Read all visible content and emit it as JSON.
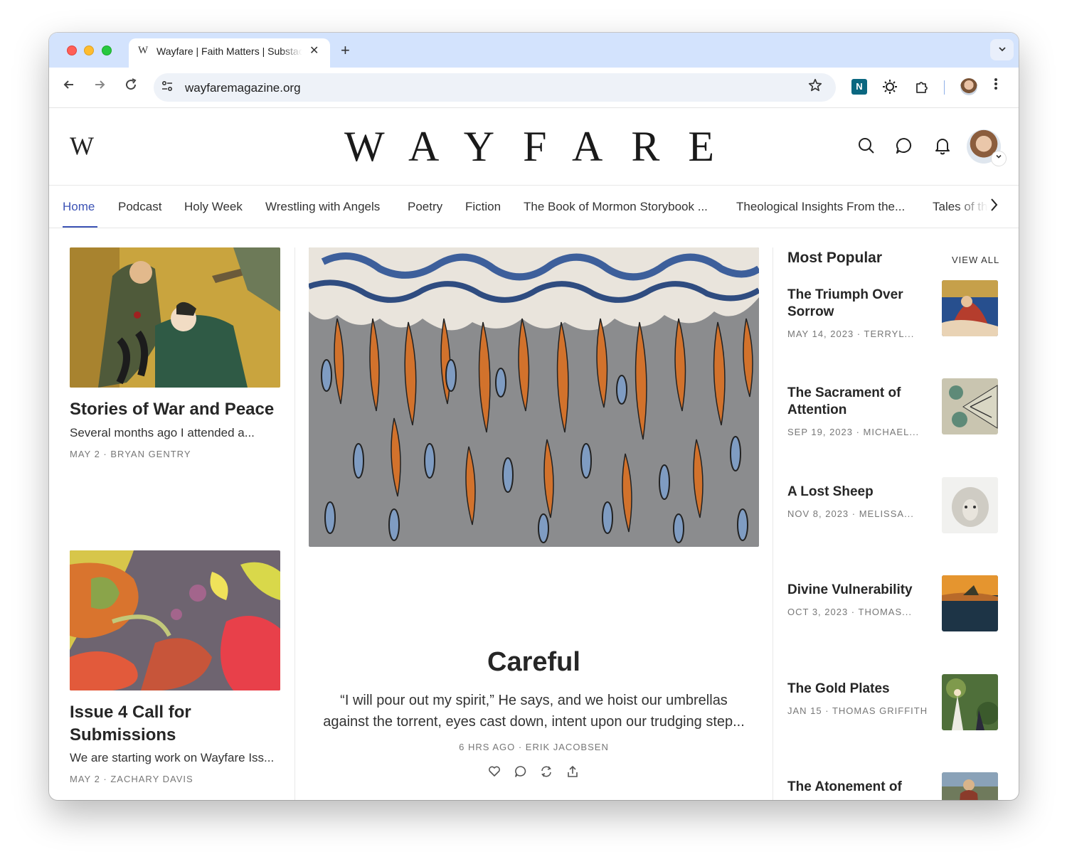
{
  "browser": {
    "tab_title": "Wayfare | Faith Matters | Substack",
    "tab_favicon": "W",
    "url": "wayfaremagazine.org",
    "new_tab_symbol": "+",
    "close_symbol": "✕",
    "dropdown_symbol": "⌄",
    "ext_label": "N"
  },
  "site": {
    "logo": "W",
    "wordmark": "WAYFARE"
  },
  "nav": {
    "items": [
      "Home",
      "Podcast",
      "Holy Week",
      "Wrestling with Angels",
      "Poetry",
      "Fiction",
      "The Book of Mormon Storybook ...",
      "Theological Insights From the..."
    ],
    "overflow_item": "Tales of the"
  },
  "left_cards": [
    {
      "title": "Stories of War and Peace",
      "subtitle": "Several months ago I attended a...",
      "meta": "MAY 2 · BRYAN GENTRY"
    },
    {
      "title": "Issue 4 Call for Submissions",
      "subtitle": "We are starting work on Wayfare Iss...",
      "meta": "MAY 2 · ZACHARY DAVIS"
    }
  ],
  "hero": {
    "title": "Careful",
    "subtitle": "“I will pour out my spirit,” He says, and we hoist our umbrellas against the torrent, eyes cast down, intent upon our trudging step...",
    "meta": "6 HRS AGO · ERIK JACOBSEN"
  },
  "sidebar": {
    "title": "Most Popular",
    "view_all": "VIEW ALL",
    "items": [
      {
        "title": "The Triumph Over Sorrow",
        "meta": "MAY 14, 2023 · TERRYL..."
      },
      {
        "title": "The Sacrament of Attention",
        "meta": "SEP 19, 2023 · MICHAEL..."
      },
      {
        "title": "A Lost Sheep",
        "meta": "NOV 8, 2023 · MELISSA..."
      },
      {
        "title": "Divine Vulnerability",
        "meta": "OCT 3, 2023 · THOMAS..."
      },
      {
        "title": "The Gold Plates",
        "meta": "JAN 15 · THOMAS GRIFFITH"
      },
      {
        "title": "The Atonement of",
        "meta": ""
      }
    ]
  },
  "colors": {
    "accent": "#3c53b5",
    "tabstrip": "#d3e3fd",
    "text": "#262626",
    "meta": "#777777"
  },
  "icons": [
    "back-icon",
    "forward-icon",
    "reload-icon",
    "tune-icon",
    "star-icon",
    "search-icon",
    "comment-icon",
    "bell-icon",
    "heart-icon",
    "restack-icon",
    "share-icon"
  ]
}
